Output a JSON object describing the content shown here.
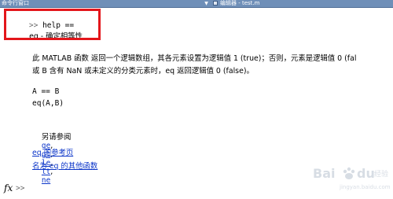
{
  "window": {
    "title": "命令行窗口",
    "editor_tab_title": "编辑器 - test.m"
  },
  "console": {
    "prompt": ">>",
    "command": "help ==",
    "help_title": "eq - 确定相等性",
    "desc_line1": "此 MATLAB 函数 返回一个逻辑数组，其各元素设置为逻辑值 1 (true)；否则，元素是逻辑值 0 (fal",
    "desc_line2": "或 B 含有 NaN 或未定义的分类元素时，eq 返回逻辑值 0 (false)。",
    "syntax1": "A == B",
    "syntax2": "eq(A,B)",
    "see_also_label": "另请参阅",
    "see_also_links": [
      "ge",
      "gt",
      "le",
      "lt",
      "ne"
    ],
    "ref_link": "eq 的参考页",
    "other_funcs_link": "名为 eq 的其他函数"
  },
  "input_line": {
    "fx_label": "fx",
    "prompt": ">>"
  },
  "watermark": {
    "text": "Baidu 经验",
    "sub": "jingyan.baidu.com"
  },
  "colors": {
    "titlebar": "#6f8fb8",
    "link": "#0b35c9",
    "highlight": "#e3161b"
  }
}
